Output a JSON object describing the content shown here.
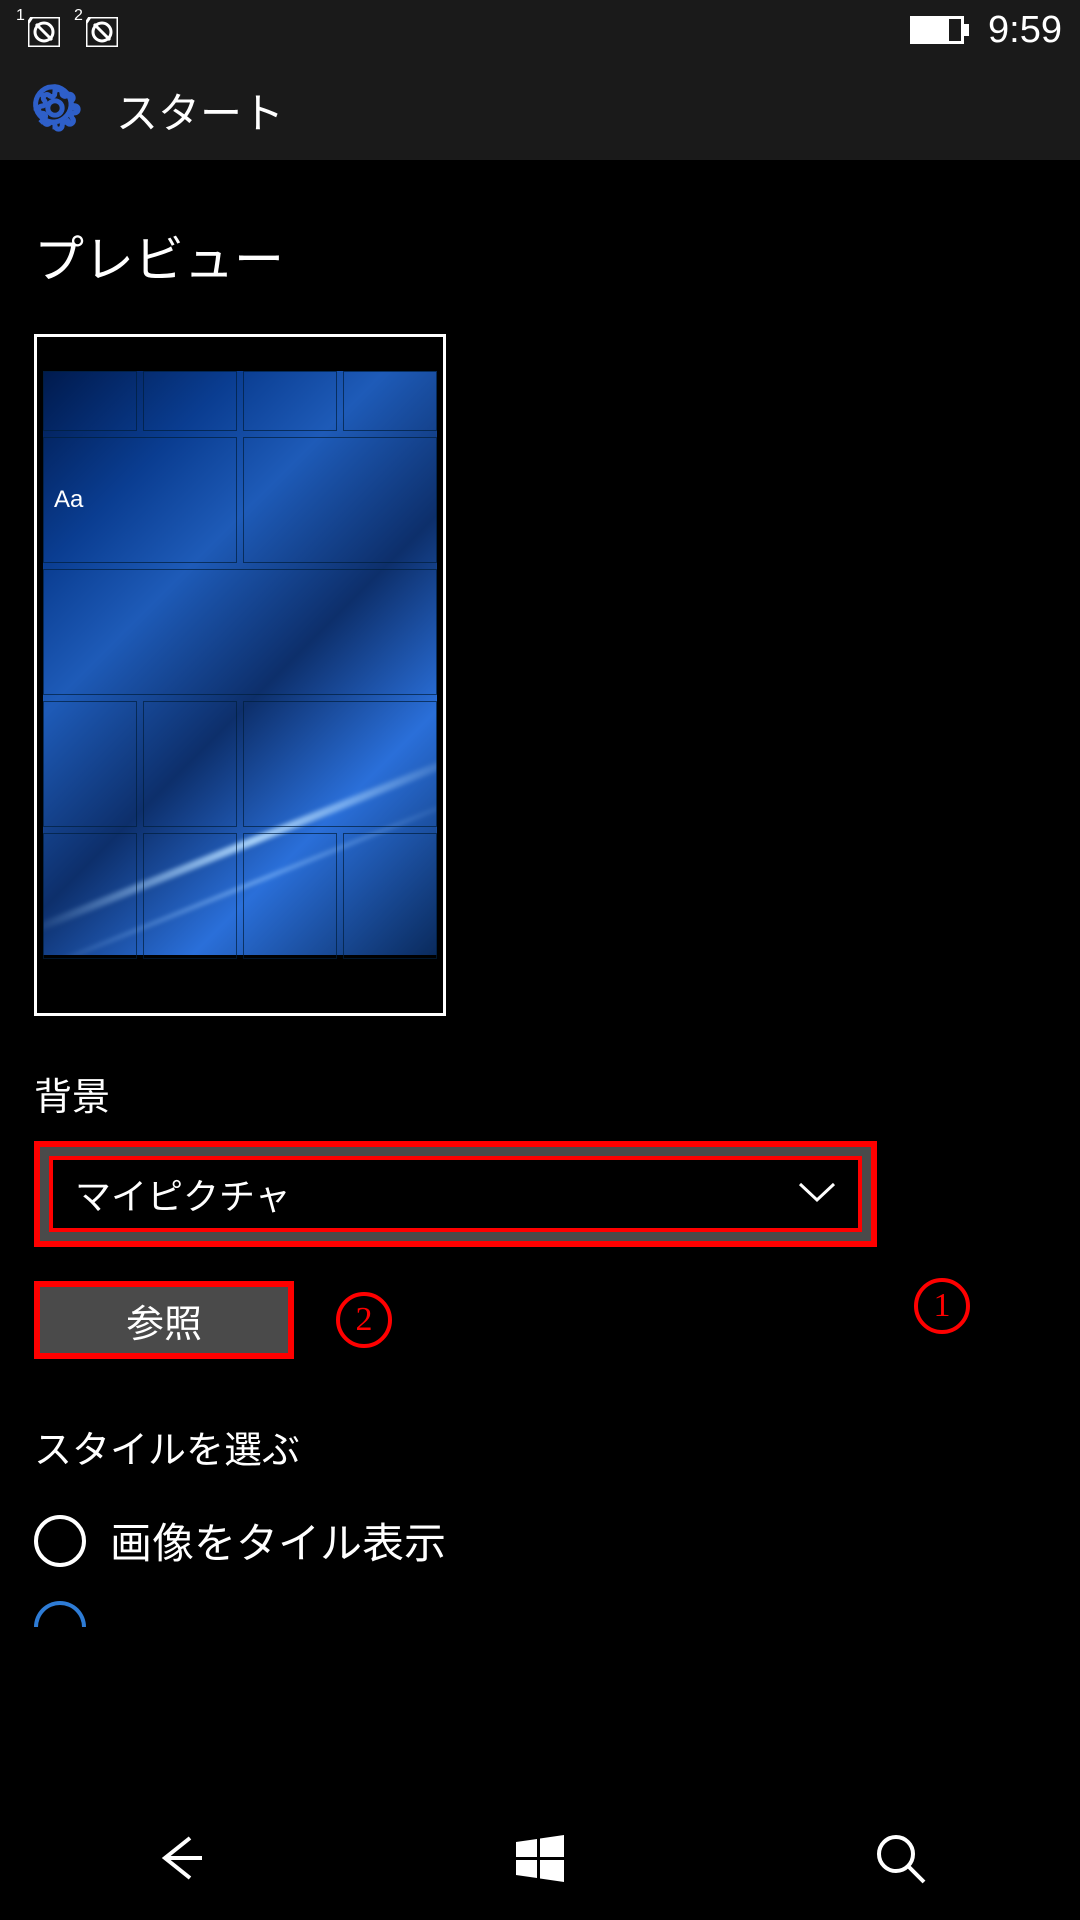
{
  "status_bar": {
    "sim1_label": "1",
    "sim2_label": "2",
    "time": "9:59"
  },
  "header": {
    "title": "スタート"
  },
  "preview": {
    "title": "プレビュー",
    "sample_text": "Aa"
  },
  "background": {
    "label": "背景",
    "selected": "マイピクチャ",
    "browse_label": "参照"
  },
  "annotations": {
    "one": "1",
    "two": "2"
  },
  "style": {
    "label": "スタイルを選ぶ",
    "option1": "画像をタイル表示"
  }
}
